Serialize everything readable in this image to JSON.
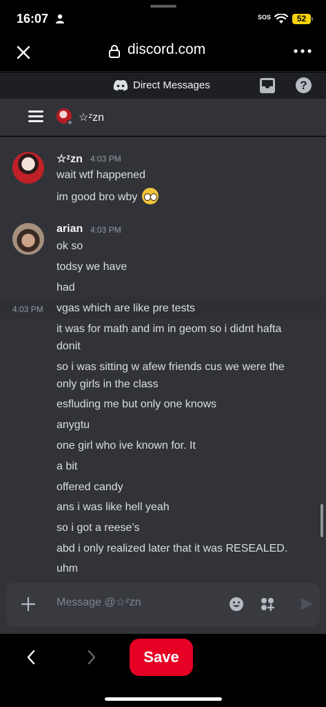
{
  "status_bar": {
    "time": "16:07",
    "sos": "SOS",
    "battery": "52"
  },
  "browser": {
    "url": "discord.com"
  },
  "discord": {
    "section_title": "Direct Messages",
    "help_label": "?",
    "channel_name": "☆ᶻzn"
  },
  "messages": {
    "group1": {
      "author": "☆ᶻzn",
      "time": "4:03 PM",
      "lines": [
        "wait wtf happened",
        "im good bro wby"
      ]
    },
    "group2": {
      "author": "arian",
      "time": "4:03 PM",
      "hover_time": "4:03 PM",
      "lines": [
        "ok so",
        "todsy we have",
        "had",
        "vgas which are like pre tests",
        "it was for math and im in geom so i didnt hafta",
        "donit",
        "so i was sitting w afew friends cus we were the",
        "only girls in the class",
        "esfluding me but only one knows",
        "anygtu",
        "one girl who ive known for. It",
        "a bit",
        "offered candy",
        "ans i was like hell yeah",
        "so i got a reese’s",
        "abd i only realized later that it was RESEALED.",
        "uhm"
      ]
    }
  },
  "composer": {
    "placeholder": "Message @☆ᶻzn"
  },
  "bottom_bar": {
    "save_label": "Save"
  },
  "colors": {
    "discord_bg": "#313338",
    "header_bg": "#1e1f22",
    "save_red": "#e60023",
    "battery_yellow": "#f5d20a"
  }
}
